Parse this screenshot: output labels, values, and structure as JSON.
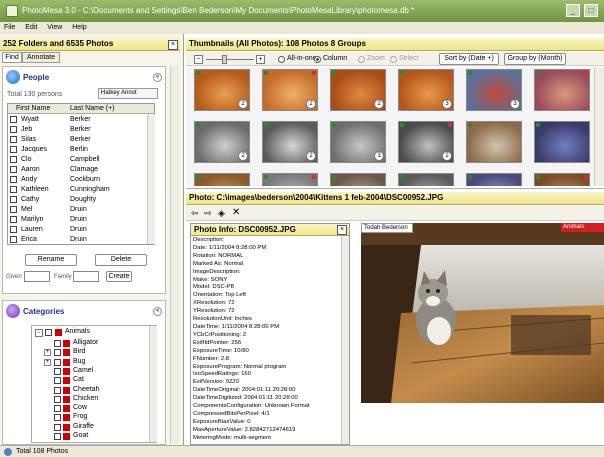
{
  "window": {
    "title": "PhotoMesa 3.0 - C:\\Documents and Settings\\Ben Bederson\\My Documents\\PhotoMesaLibrary\\photomesa.db *"
  },
  "menu": [
    "File",
    "Edit",
    "View",
    "Help"
  ],
  "left": {
    "header": "252 Folders and 6535 Photos",
    "tabs": [
      "Find",
      "Annotate"
    ],
    "people": {
      "title": "People",
      "total": "Total 130 persons",
      "filter": "Hatkey Annot",
      "columns": [
        "First Name",
        "Last Name (+)"
      ],
      "rows": [
        [
          "Wyatt",
          "Berker"
        ],
        [
          "Jeb",
          "Berker"
        ],
        [
          "Silas",
          "Berker"
        ],
        [
          "Jacques",
          "Berlin"
        ],
        [
          "Clo",
          "Campbell"
        ],
        [
          "Aaron",
          "Clamage"
        ],
        [
          "Andy",
          "Cockburn"
        ],
        [
          "Kathleen",
          "Cunningham"
        ],
        [
          "Cathy",
          "Doughty"
        ],
        [
          "Mel",
          "Druin"
        ],
        [
          "Marilyn",
          "Druin"
        ],
        [
          "Lauren",
          "Druin"
        ],
        [
          "Erica",
          "Druin"
        ]
      ],
      "rename": "Rename",
      "delete": "Delete",
      "given": "Given",
      "family": "Family",
      "create": "Create"
    },
    "categories": {
      "title": "Categories",
      "root": "Animals",
      "items": [
        "Alligator",
        "Bird",
        "Bug",
        "Camel",
        "Cat",
        "Cheetah",
        "Chicken",
        "Cow",
        "Frog",
        "Giraffe",
        "Goat"
      ]
    }
  },
  "thumbs": {
    "header": "Thumbnails (All Photos): 108 Photos 8 Groups",
    "toolbar": {
      "allinone": "All-in-one",
      "column": "Column",
      "zoom": "Zoom",
      "select": "Select",
      "sort": "Sort by (Date +)",
      "group": "Group by (Month)"
    },
    "badges": [
      "2",
      "2",
      "2",
      "3",
      "3",
      "",
      "2",
      "2",
      "3",
      "2",
      "",
      "",
      "",
      "",
      "",
      "",
      "",
      ""
    ]
  },
  "photo": {
    "header": "Photo: C:\\images\\bederson\\2004\\Kittens 1 feb-2004\\DSC00952.JPG",
    "info_header": "Photo Info: DSC00952.JPG",
    "info": [
      "Description:",
      "Date: 1/11/2004 8:28:00 PM",
      "Rotation: NORMAL",
      "Marked As: Normal",
      "ImageDescription:",
      "Make: SONY",
      "Model: DSC-P8",
      "Orientation: Top Left",
      "XResolution: 72",
      "YResolution: 72",
      "ResolutionUnit: Inches",
      "DateTime: 1/11/2004 8:28:00 PM",
      "YCbCrPositioning: 2",
      "ExifIfdPointer: 256",
      "ExposureTime: 10/80",
      "FNumber: 2.8",
      "ExposureProgram: Normal program",
      "IsoSpeedRatings: 160",
      "ExifVersion: 0220",
      "DateTimeOriginal: 2004:01:11 20:28:00",
      "DateTimeDigitized: 2004:01:11 20:28:00",
      "ComponentsConfiguration: Unknown Format",
      "CompressedBitsPerPixel: 4/1",
      "ExposureBiasValue: 0",
      "MaxApertureValue: 2.82842712474619",
      "MeteringMode: multi-segment"
    ],
    "person_tag": "Todah Bederson",
    "red_tag": "Animals"
  },
  "status": "Total 108 Photos"
}
